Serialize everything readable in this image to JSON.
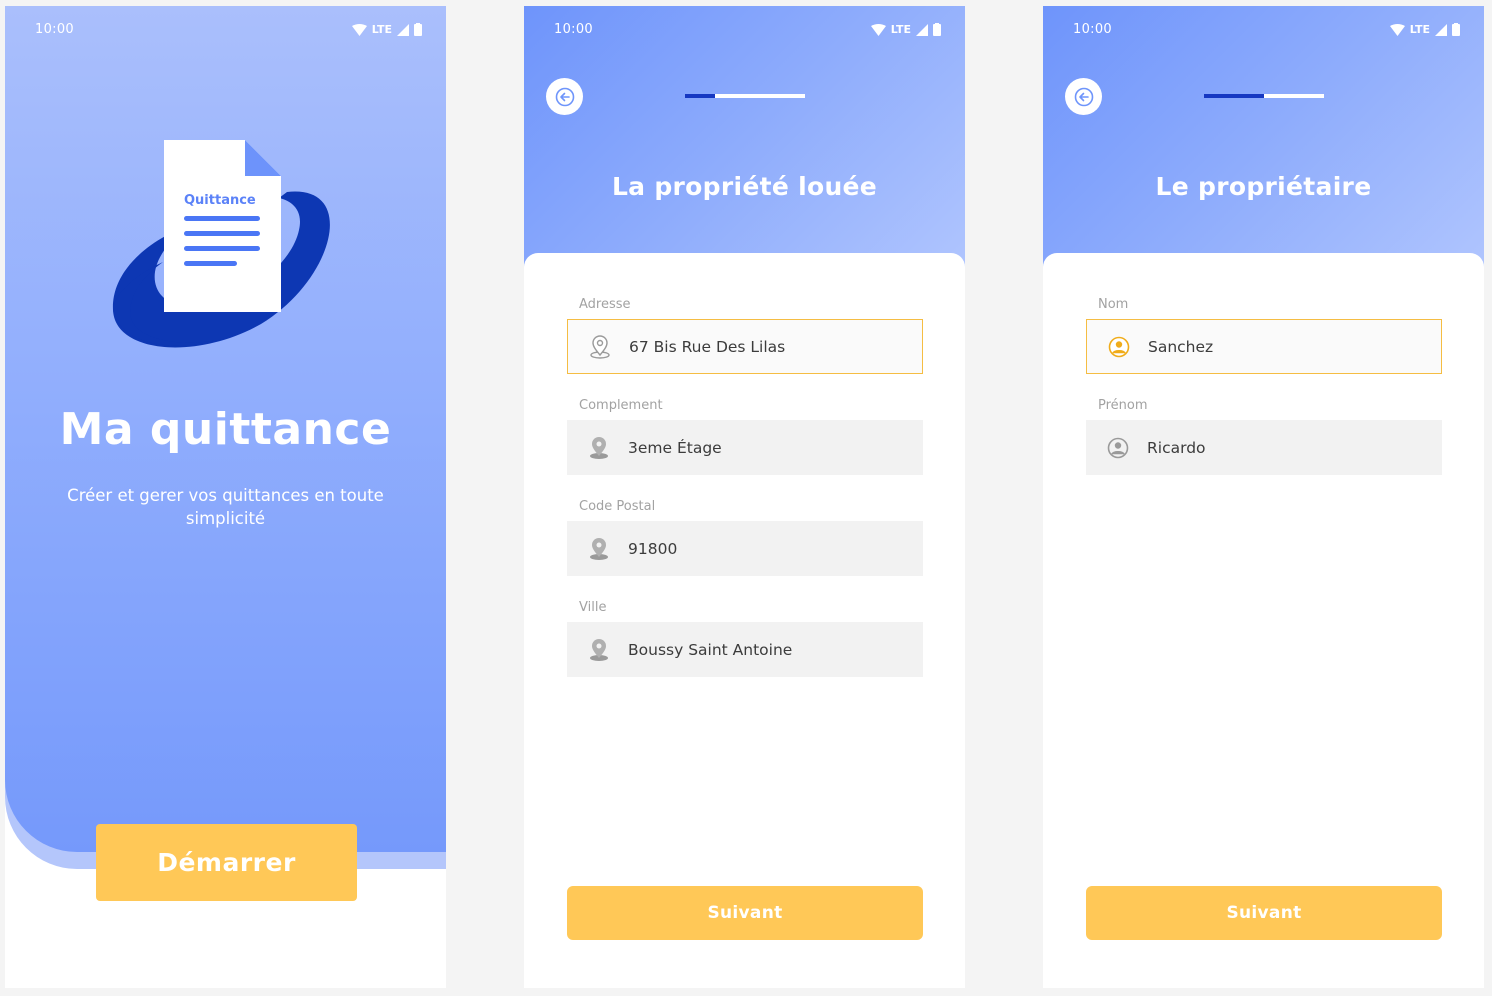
{
  "status_bar": {
    "time": "10:00",
    "network": "LTE"
  },
  "colors": {
    "primary_blue": "#7599fb",
    "light_blue": "#aabffc",
    "accent_yellow": "#ffc857",
    "focus_border": "#f5bd43",
    "progress_fill": "#1638c2",
    "field_bg": "#f2f2f2"
  },
  "welcome": {
    "logo_label": "Quittance",
    "title": "Ma quittance",
    "subtitle": "Créer et gerer vos quittances en toute simplicité",
    "start_label": "Démarrer"
  },
  "property": {
    "title": "La propriété louée",
    "progress": 0.25,
    "back_icon": "arrow-left-icon",
    "fields": [
      {
        "label": "Adresse",
        "value": "67 Bis Rue Des Lilas",
        "icon": "location-pin-icon",
        "focused": true
      },
      {
        "label": "Complement",
        "value": "3eme Étage",
        "icon": "location-pin-icon",
        "focused": false
      },
      {
        "label": "Code Postal",
        "value": "91800",
        "icon": "location-pin-icon",
        "focused": false
      },
      {
        "label": "Ville",
        "value": "Boussy Saint Antoine",
        "icon": "location-pin-icon",
        "focused": false
      }
    ],
    "next_label": "Suivant"
  },
  "owner": {
    "title": "Le propriétaire",
    "progress": 0.5,
    "back_icon": "arrow-left-icon",
    "fields": [
      {
        "label": "Nom",
        "value": "Sanchez",
        "icon": "user-circle-icon",
        "focused": true
      },
      {
        "label": "Prénom",
        "value": "Ricardo",
        "icon": "user-circle-icon",
        "focused": false
      }
    ],
    "next_label": "Suivant"
  }
}
